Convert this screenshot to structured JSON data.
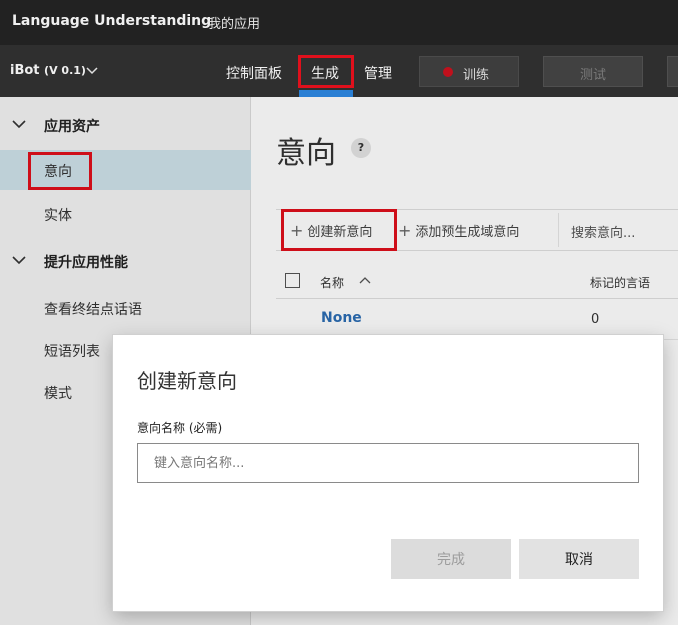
{
  "topbar": {
    "brand": "Language Understanding",
    "my_apps": "我的应用"
  },
  "appbar": {
    "app_name": "iBot",
    "version": "(V 0.1)",
    "tabs": [
      {
        "label": "控制面板"
      },
      {
        "label": "生成",
        "active": true
      },
      {
        "label": "管理"
      }
    ],
    "train_label": "训练",
    "test_label": "测试",
    "colors": {
      "accent": "#2a7fd4",
      "highlight": "#e0101c",
      "train_dot": "#c0101c"
    }
  },
  "sidebar": {
    "sections": [
      {
        "label": "应用资产",
        "items": [
          {
            "label": "意向",
            "active": true
          },
          {
            "label": "实体"
          }
        ]
      },
      {
        "label": "提升应用性能",
        "items": [
          {
            "label": "查看终结点话语"
          },
          {
            "label": "短语列表"
          },
          {
            "label": "模式"
          }
        ]
      }
    ]
  },
  "main": {
    "title": "意向",
    "help": "?",
    "commands": {
      "create": "创建新意向",
      "prebuilt": "添加预生成域意向",
      "search_placeholder": "搜索意向..."
    },
    "table": {
      "headers": {
        "name": "名称",
        "utterances": "标记的言语"
      },
      "rows": [
        {
          "name": "None",
          "count": "0"
        }
      ]
    }
  },
  "dialog": {
    "title": "创建新意向",
    "field_label": "意向名称 (必需)",
    "field_placeholder": "键入意向名称...",
    "field_value": "",
    "done_label": "完成",
    "cancel_label": "取消"
  }
}
